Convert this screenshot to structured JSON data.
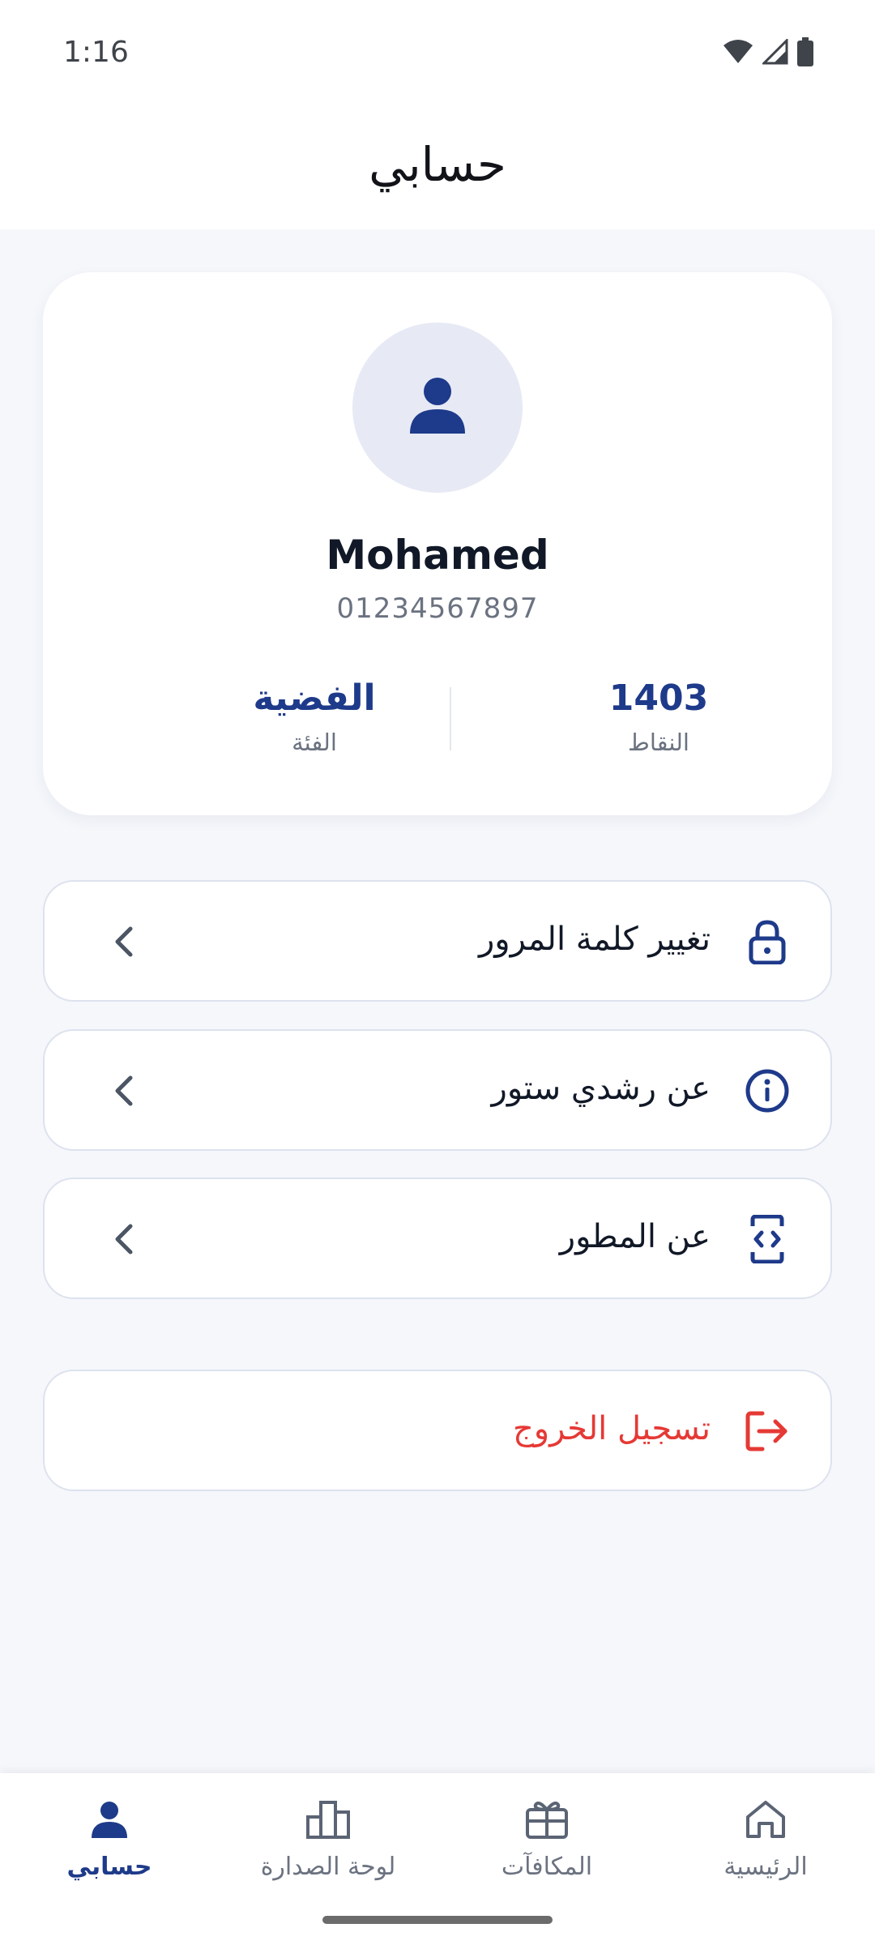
{
  "status_bar": {
    "time": "1:16",
    "icons": [
      "wifi-icon",
      "signal-icon",
      "battery-icon"
    ]
  },
  "header": {
    "title": "حسابي"
  },
  "profile": {
    "name": "Mohamed",
    "phone": "01234567897",
    "avatar_icon": "person-icon",
    "stats": {
      "points_value": "1403",
      "points_label": "النقاط",
      "category_value": "الفضية",
      "category_label": "الفئة"
    }
  },
  "menu": {
    "items": [
      {
        "label": "تغيير كلمة المرور",
        "icon": "lock-icon"
      },
      {
        "label": "عن رشدي ستور",
        "icon": "info-icon"
      },
      {
        "label": "عن المطور",
        "icon": "code-icon"
      }
    ],
    "logout": {
      "label": "تسجيل الخروج",
      "icon": "logout-icon"
    }
  },
  "bottom_nav": {
    "items": [
      {
        "label": "حسابي",
        "icon": "person-icon",
        "active": true
      },
      {
        "label": "لوحة الصدارة",
        "icon": "leaderboard-icon",
        "active": false
      },
      {
        "label": "المكافآت",
        "icon": "gift-icon",
        "active": false
      },
      {
        "label": "الرئيسية",
        "icon": "home-icon",
        "active": false
      }
    ]
  },
  "colors": {
    "primary": "#1e3a8a",
    "danger": "#e53935",
    "background": "#f5f7fb",
    "muted_text": "#6b7280"
  }
}
